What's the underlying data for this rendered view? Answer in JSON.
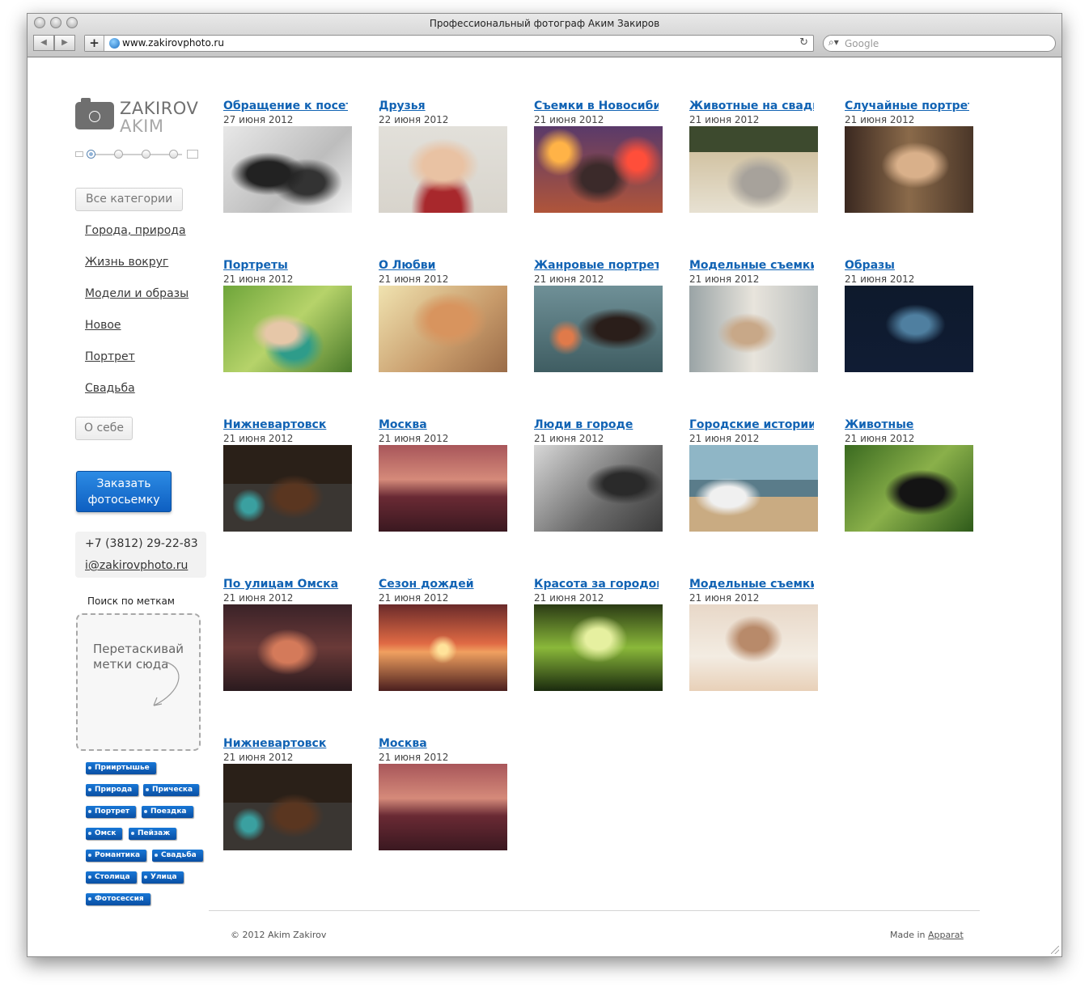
{
  "browser": {
    "window_title": "Профессиональный фотограф Аким Закиров",
    "url": "www.zakirovphoto.ru",
    "search_placeholder": "Google",
    "back_icon": "back-arrow-icon",
    "forward_icon": "forward-arrow-icon",
    "add_label": "+"
  },
  "logo": {
    "line1": "ZAKIROV",
    "line2": "AKIM"
  },
  "sidebar": {
    "all_categories": "Все категории",
    "categories": [
      "Города, природа",
      "Жизнь вокруг",
      "Модели и образы",
      "Новое",
      "Портрет",
      "Свадьба"
    ],
    "about": "О себе",
    "order_button": [
      "Заказать",
      "фотосьемку"
    ],
    "phone": "+7 (3812) 29-22-83",
    "email": "i@zakirovphoto.ru",
    "tag_search_label": "Поиск по меткам",
    "drop_text": "Перетаскивай метки сюда",
    "tags": [
      "Прииртышье",
      "Природа",
      "Прическа",
      "Портрет",
      "Поездка",
      "Омск",
      "Пейзаж",
      "Романтика",
      "Свадьба",
      "Столица",
      "Улица",
      "Фотосессия"
    ]
  },
  "gallery": [
    {
      "title": "Обращение к посетителям",
      "date": "27 июня 2012"
    },
    {
      "title": "Друзья",
      "date": "22 июня 2012"
    },
    {
      "title": "Съемки в Новосибирске",
      "date": "21 июня 2012"
    },
    {
      "title": "Животные на свадьбе",
      "date": "21 июня 2012"
    },
    {
      "title": "Случайные портреты",
      "date": "21 июня 2012"
    },
    {
      "title": "Портреты",
      "date": "21 июня 2012"
    },
    {
      "title": "О Любви",
      "date": "21 июня 2012"
    },
    {
      "title": "Жанровые портреты",
      "date": "21 июня 2012"
    },
    {
      "title": "Модельные съемки",
      "date": "21 июня 2012"
    },
    {
      "title": "Образы",
      "date": "21 июня 2012"
    },
    {
      "title": "Нижневартовск",
      "date": "21 июня 2012"
    },
    {
      "title": "Москва",
      "date": "21 июня 2012"
    },
    {
      "title": "Люди в городе",
      "date": "21 июня 2012"
    },
    {
      "title": "Городские истории",
      "date": "21 июня 2012"
    },
    {
      "title": "Животные",
      "date": "21 июня 2012"
    },
    {
      "title": "По улицам Омска",
      "date": "21 июня 2012"
    },
    {
      "title": "Сезон дождей",
      "date": "21 июня 2012"
    },
    {
      "title": "Красота за городом",
      "date": "21 июня 2012"
    },
    {
      "title": "Модельные съемки М",
      "date": "21 июня 2012"
    },
    {
      "title": "Нижневартовск",
      "date": "21 июня 2012"
    },
    {
      "title": "Москва",
      "date": "21 июня 2012"
    }
  ],
  "footer": {
    "copyright": "© 2012 Akim Zakirov",
    "made_in_prefix": "Made in ",
    "made_in_link": "Apparat"
  },
  "colors": {
    "link_blue": "#1163b4",
    "button_blue": "#0e5fc1",
    "tag_blue": "#0a4fa3"
  }
}
